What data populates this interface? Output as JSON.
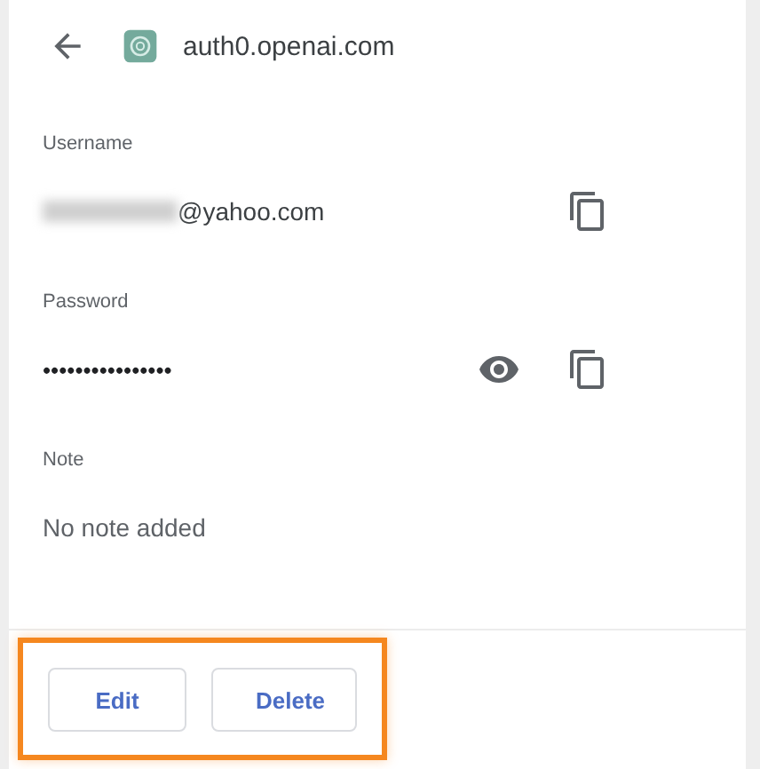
{
  "header": {
    "site": "auth0.openai.com"
  },
  "fields": [
    {
      "kind": "username",
      "label": "Username",
      "value": "@yahoo.com",
      "redacted": true,
      "actions": [
        {
          "kind": "copy"
        }
      ]
    },
    {
      "kind": "password",
      "label": "Password",
      "value": "••••••••••••••••",
      "actions": [
        {
          "kind": "show"
        },
        {
          "kind": "copy"
        }
      ]
    },
    {
      "kind": "note",
      "label": "Note",
      "value": "No note added"
    }
  ],
  "buttons": [
    "Edit",
    "Delete"
  ],
  "buttons_highlighted": true
}
